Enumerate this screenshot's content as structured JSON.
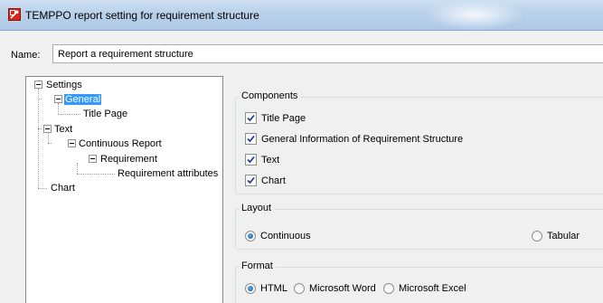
{
  "window": {
    "title": "TEMPPO report setting for requirement structure"
  },
  "name_field": {
    "label": "Name:",
    "value": "Report a requirement structure"
  },
  "tree": {
    "settings": "Settings",
    "general": "General",
    "title_page": "Title Page",
    "text": "Text",
    "continuous_report": "Continuous Report",
    "requirement": "Requirement",
    "requirement_attributes": "Requirement attributes",
    "chart": "Chart"
  },
  "components": {
    "title": "Components",
    "items": [
      {
        "label": "Title Page",
        "checked": true
      },
      {
        "label": "General Information of Requirement Structure",
        "checked": true
      },
      {
        "label": "Text",
        "checked": true
      },
      {
        "label": "Chart",
        "checked": true
      }
    ]
  },
  "layout": {
    "title": "Layout",
    "options": [
      {
        "label": "Continuous",
        "selected": true
      },
      {
        "label": "Tabular",
        "selected": false
      }
    ]
  },
  "format": {
    "title": "Format",
    "options": [
      {
        "label": "HTML",
        "selected": true
      },
      {
        "label": "Microsoft Word",
        "selected": false
      },
      {
        "label": "Microsoft Excel",
        "selected": false
      }
    ]
  }
}
